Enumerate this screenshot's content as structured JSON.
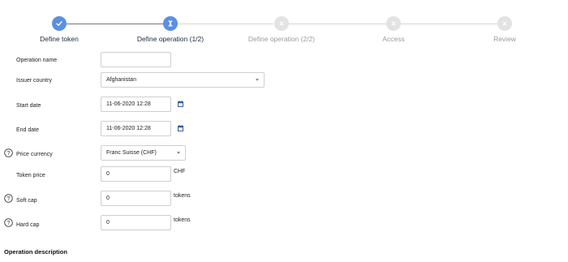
{
  "stepper": {
    "steps": [
      {
        "label": "Define token",
        "state": "done"
      },
      {
        "label": "Define operation (1/2)",
        "state": "current"
      },
      {
        "label": "Define operation (2/2)",
        "state": "pending"
      },
      {
        "label": "Access",
        "state": "pending"
      },
      {
        "label": "Review",
        "state": "pending"
      }
    ]
  },
  "form": {
    "operation_name": {
      "label": "Operation name",
      "value": ""
    },
    "issuer_country": {
      "label": "Issuer country",
      "value": "Afghanistan"
    },
    "start_date": {
      "label": "Start date",
      "value": "11-06-2020 12:28"
    },
    "end_date": {
      "label": "End date",
      "value": "11-06-2020 12:28"
    },
    "price_currency": {
      "label": "Price currency",
      "value": "Franc Suisse (CHF)"
    },
    "token_price": {
      "label": "Token price",
      "value": "0",
      "suffix": "CHF"
    },
    "soft_cap": {
      "label": "Soft cap",
      "value": "0",
      "suffix": "tokens"
    },
    "hard_cap": {
      "label": "Hard cap",
      "value": "0",
      "suffix": "tokens"
    }
  },
  "section": {
    "operation_description": "Operation description"
  },
  "colors": {
    "accent": "#5b8fe0",
    "inactive_step": "#e3e3e3",
    "calendar_icon": "#3b5d9c"
  }
}
